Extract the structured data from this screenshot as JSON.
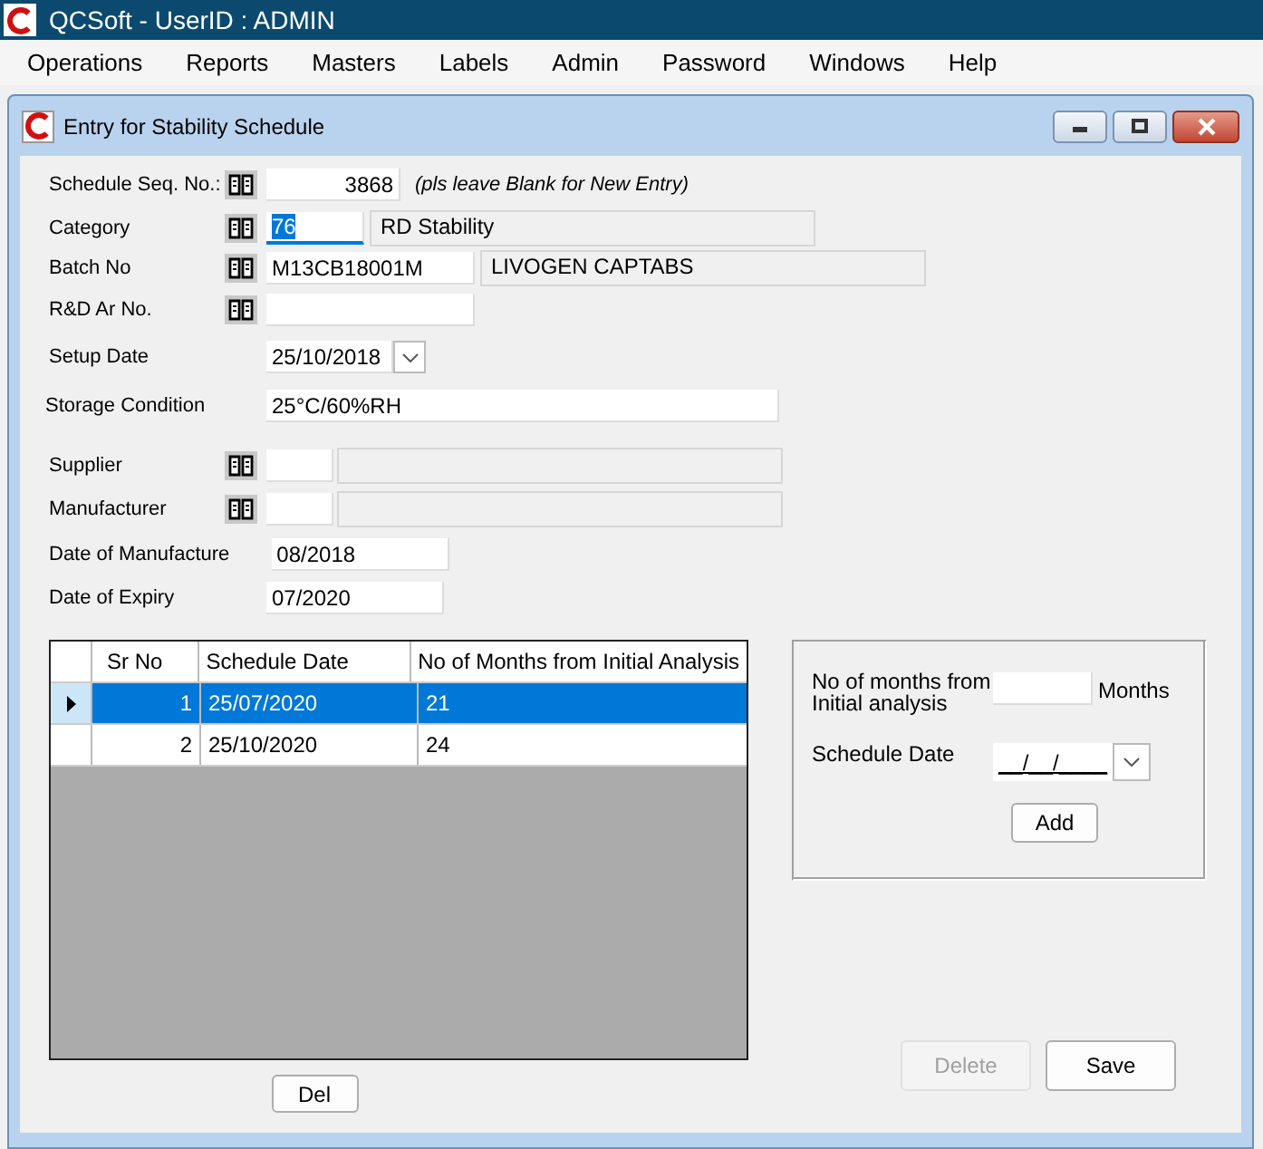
{
  "app": {
    "title": "QCSoft - UserID : ADMIN"
  },
  "menu": [
    "Operations",
    "Reports",
    "Masters",
    "Labels",
    "Admin",
    "Password",
    "Windows",
    "Help"
  ],
  "window": {
    "title": "Entry for Stability Schedule"
  },
  "fields": [
    {
      "kind": "seq",
      "label": "Schedule Seq. No.:",
      "lookup": true,
      "value": "3868",
      "hint": "(pls leave Blank for New Entry)",
      "focused": false
    },
    {
      "kind": "code",
      "label": "Category",
      "lookup": true,
      "value": "76",
      "description": "RD Stability",
      "focused": true
    },
    {
      "kind": "batch",
      "label": "Batch No",
      "lookup": true,
      "value": "M13CB18001M",
      "description": "LIVOGEN CAPTABS",
      "focused": false
    },
    {
      "kind": "text",
      "label": "R&D Ar No.",
      "lookup": true,
      "focused": false
    },
    {
      "kind": "date",
      "label": "Setup Date",
      "lookup": false,
      "value": "25/10/2018",
      "focused": false
    },
    {
      "kind": "wide",
      "label": "Storage Condition",
      "lookup": false,
      "value": "25°C/60%RH",
      "focused": false
    },
    {
      "kind": "short",
      "label": "Supplier",
      "lookup": true,
      "focused": false
    },
    {
      "kind": "short",
      "label": "Manufacturer",
      "lookup": true,
      "focused": false
    },
    {
      "kind": "month",
      "label": "Date of Manufacture",
      "lookup": false,
      "value": "08/2018",
      "focused": false
    },
    {
      "kind": "month",
      "label": "Date of Expiry",
      "lookup": false,
      "value": "07/2020",
      "focused": false
    }
  ],
  "table": {
    "columns": [
      "Sr No",
      "Schedule Date",
      "No of Months from Initial Analysis"
    ],
    "rows": [
      {
        "cells": [
          "1",
          "25/07/2020",
          "21"
        ],
        "selected": true
      },
      {
        "cells": [
          "2",
          "25/10/2020",
          "24"
        ],
        "selected": false
      }
    ]
  },
  "del_button": "Del",
  "panel": {
    "months_label": "No of months from Initial analysis",
    "months_unit": "Months",
    "date_label": "Schedule Date",
    "date_value": "__/__/____",
    "add_button": "Add"
  },
  "buttons": [
    {
      "label": "Delete",
      "disabled": true
    },
    {
      "label": "Save",
      "disabled": false
    }
  ]
}
